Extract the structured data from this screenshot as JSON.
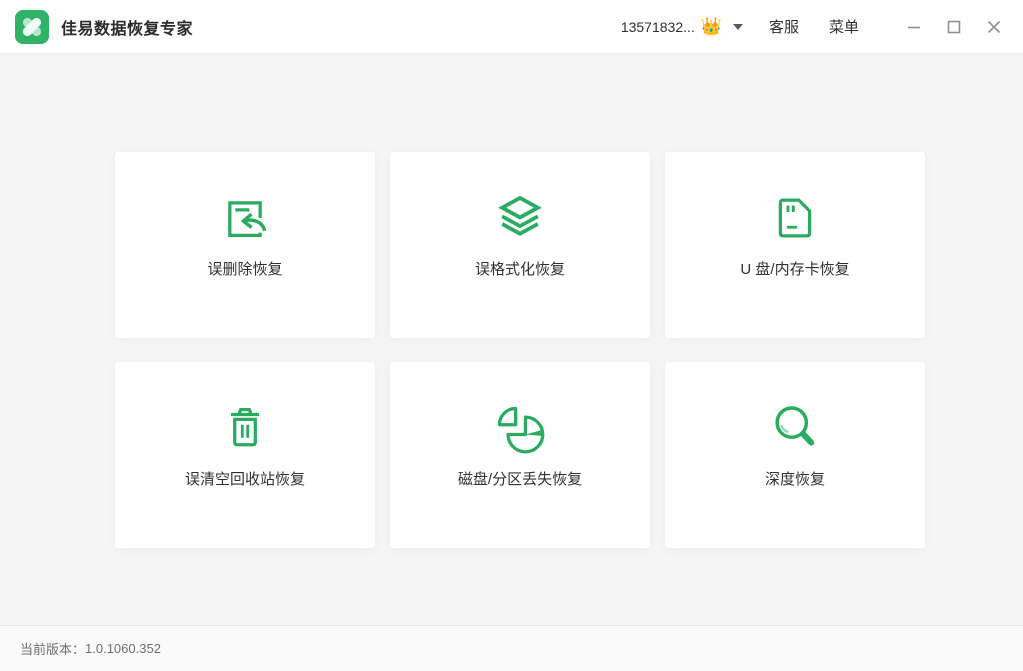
{
  "titlebar": {
    "app_title": "佳易数据恢复专家",
    "account": "13571832...",
    "crown_icon": "👑",
    "service_label": "客服",
    "menu_label": "菜单"
  },
  "cards": [
    {
      "label": "误删除恢复",
      "icon": "undo-file-icon"
    },
    {
      "label": "误格式化恢复",
      "icon": "layers-icon"
    },
    {
      "label": "U 盘/内存卡恢复",
      "icon": "sd-card-icon"
    },
    {
      "label": "误清空回收站恢复",
      "icon": "trash-icon"
    },
    {
      "label": "磁盘/分区丢失恢复",
      "icon": "pie-chart-icon"
    },
    {
      "label": "深度恢复",
      "icon": "magnifier-icon"
    }
  ],
  "statusbar": {
    "version_label": "当前版本：",
    "version_value": "1.0.1060.352"
  },
  "colors": {
    "accent_green": "#2bab60",
    "logo_green": "#30b267",
    "background": "#f5f5f6",
    "card_background": "#ffffff",
    "text_dark": "#303030",
    "text_muted": "#6e6e6e",
    "window_control_gray": "#8f8f8f"
  }
}
